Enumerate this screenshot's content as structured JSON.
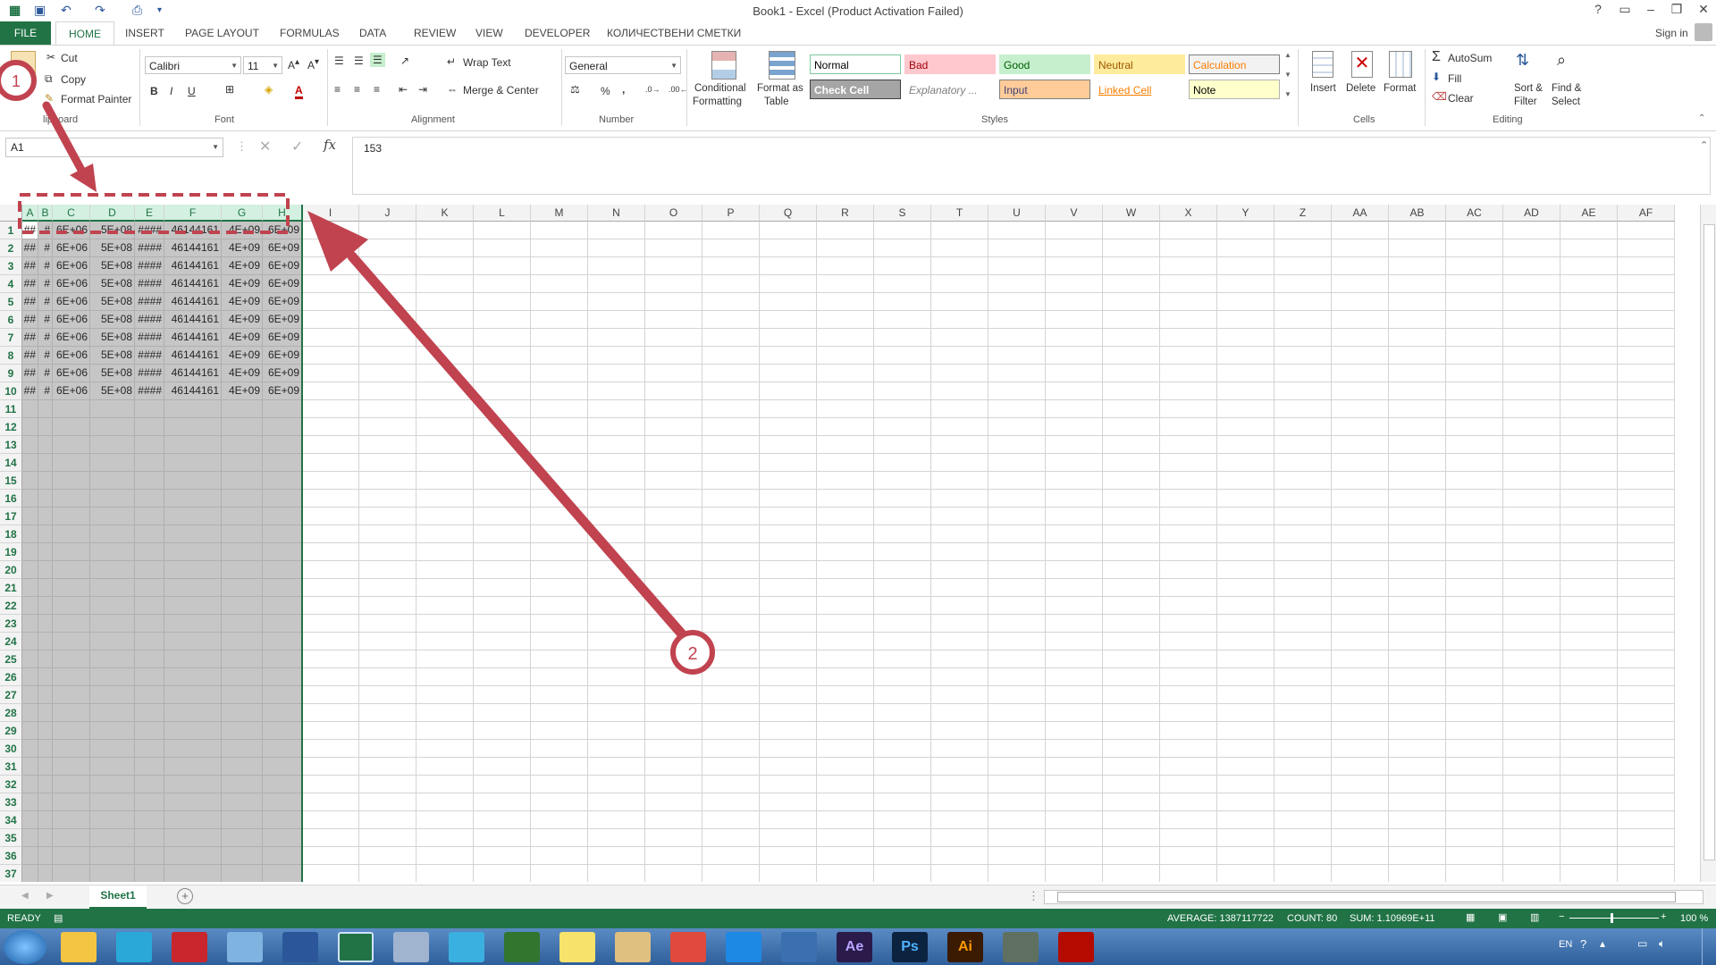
{
  "window": {
    "title": "Book1 - Excel (Product Activation Failed)",
    "sign_in": "Sign in",
    "help": "?"
  },
  "tabs": [
    "FILE",
    "HOME",
    "INSERT",
    "PAGE LAYOUT",
    "FORMULAS",
    "DATA",
    "REVIEW",
    "VIEW",
    "DEVELOPER",
    "КОЛИЧЕСТВЕНИ СМЕТКИ"
  ],
  "ribbon": {
    "clipboard": {
      "cut": "Cut",
      "copy": "Copy",
      "format_painter": "Format Painter",
      "label": "lipboard"
    },
    "font": {
      "name": "Calibri",
      "size": "11",
      "bold": "B",
      "italic": "I",
      "underline": "U",
      "font_color": "A",
      "label": "Font"
    },
    "alignment": {
      "wrap_text": "Wrap Text",
      "merge_center": "Merge & Center",
      "label": "Alignment"
    },
    "number": {
      "format": "General",
      "percent": "%",
      "comma": ",",
      "label": "Number"
    },
    "styles": {
      "conditional_formatting": [
        "Conditional",
        "Formatting"
      ],
      "format_as_table": [
        "Format as",
        "Table"
      ],
      "cells": [
        {
          "label": "Normal",
          "bg": "#ffffff",
          "fg": "#000000",
          "border": "#7fc79f"
        },
        {
          "label": "Bad",
          "bg": "#ffc7ce",
          "fg": "#9c0006",
          "border": "#ffc7ce"
        },
        {
          "label": "Good",
          "bg": "#c6efce",
          "fg": "#006100",
          "border": "#c6efce"
        },
        {
          "label": "Neutral",
          "bg": "#ffeb9c",
          "fg": "#9c5700",
          "border": "#ffeb9c"
        },
        {
          "label": "Calculation",
          "bg": "#f2f2f2",
          "fg": "#fa7d00",
          "border": "#7f7f7f"
        },
        {
          "label": "Check Cell",
          "bg": "#a5a5a5",
          "fg": "#ffffff",
          "border": "#3f3f3f"
        },
        {
          "label": "Explanatory ...",
          "bg": "#ffffff",
          "fg": "#7f7f7f",
          "border": "#ffffff"
        },
        {
          "label": "Input",
          "bg": "#ffcc99",
          "fg": "#3f3f76",
          "border": "#7f7f7f"
        },
        {
          "label": "Linked Cell",
          "bg": "#ffffff",
          "fg": "#fa7d00",
          "border": "#ffffff"
        },
        {
          "label": "Note",
          "bg": "#ffffcc",
          "fg": "#000000",
          "border": "#b2b2b2"
        }
      ],
      "label": "Styles"
    },
    "cells": {
      "insert": "Insert",
      "delete": "Delete",
      "format": "Format",
      "label": "Cells"
    },
    "editing": {
      "autosum": "AutoSum",
      "fill": "Fill",
      "clear": "Clear",
      "sort_filter": [
        "Sort &",
        "Filter"
      ],
      "find_select": [
        "Find &",
        "Select"
      ],
      "label": "Editing"
    }
  },
  "formula_bar": {
    "name_box": "A1",
    "fx": "fx",
    "value": "153"
  },
  "grid": {
    "columns": [
      "A",
      "B",
      "C",
      "D",
      "E",
      "F",
      "G",
      "H",
      "I",
      "J",
      "K",
      "L",
      "M",
      "N",
      "O",
      "P",
      "Q",
      "R",
      "S",
      "T",
      "U",
      "V",
      "W",
      "X",
      "Y",
      "Z",
      "AA",
      "AB",
      "AC",
      "AD",
      "AE",
      "AF"
    ],
    "selected_columns": 8,
    "row_count": 37,
    "row_values": [
      "##",
      "#",
      "6E+06",
      "5E+08",
      "####",
      "46144161",
      "4E+09",
      "6E+09"
    ],
    "data_rows": 10
  },
  "sheet_tab": "Sheet1",
  "status": {
    "ready": "READY",
    "average": "AVERAGE: 1387117722",
    "count": "COUNT: 80",
    "sum": "SUM: 1.10969E+11",
    "zoom": "100 %"
  },
  "annotations": {
    "label1": "1",
    "label2": "2",
    "color": "#c0434f"
  },
  "taskbar": {
    "language": "EN",
    "apps": [
      "folder",
      "recycle",
      "autocad",
      "notepad",
      "word",
      "excel",
      "calculator",
      "network",
      "project",
      "sticky",
      "paint",
      "chrome",
      "ie",
      "chat",
      "after-effects",
      "photoshop",
      "illustrator",
      "terminal",
      "acrobat"
    ],
    "app_labels": {
      "after-effects": "Ae",
      "photoshop": "Ps",
      "illustrator": "Ai"
    }
  }
}
